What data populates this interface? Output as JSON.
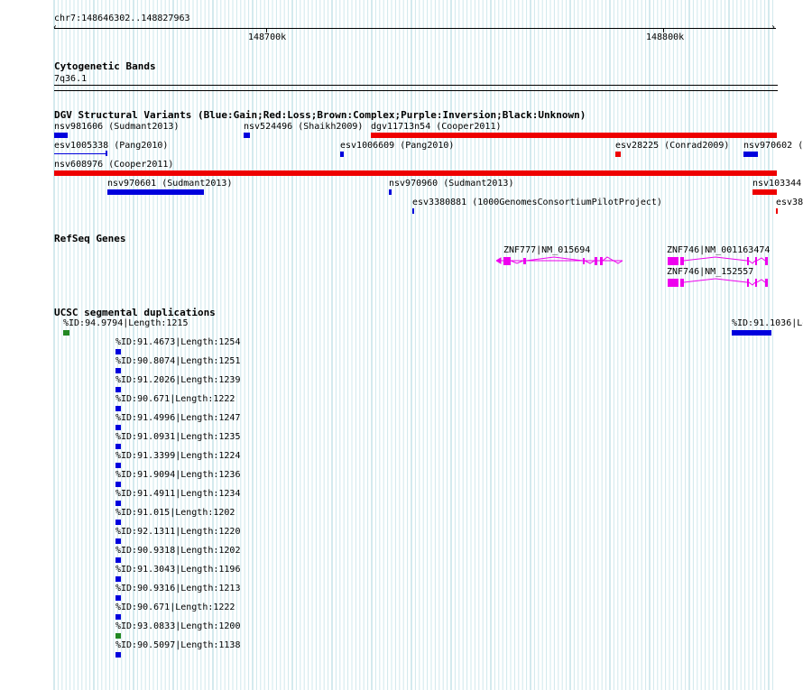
{
  "ruler": {
    "range": "chr7:148646302..148827963",
    "tick1": "148700k",
    "tick2": "148800k"
  },
  "cytoband": {
    "title": "Cytogenetic Bands",
    "band": "7q36.1"
  },
  "dgv": {
    "title": "DGV Structural Variants (Blue:Gain;Red:Loss;Brown:Complex;Purple:Inversion;Black:Unknown)",
    "items": [
      {
        "label": "nsv981606 (Sudmant2013)",
        "color": "#0000dd"
      },
      {
        "label": "nsv524496 (Shaikh2009)",
        "color": "#0000dd"
      },
      {
        "label": "dgv11713n54 (Cooper2011)",
        "color": "#ee0000"
      },
      {
        "label": "esv1005338 (Pang2010)",
        "color": "#0000dd"
      },
      {
        "label": "esv1006609 (Pang2010)",
        "color": "#0000dd"
      },
      {
        "label": "esv28225 (Conrad2009)",
        "color": "#ee0000"
      },
      {
        "label": "nsv970602 (",
        "color": "#0000dd"
      },
      {
        "label": "nsv608976 (Cooper2011)",
        "color": "#ee0000"
      },
      {
        "label": "nsv970601 (Sudmant2013)",
        "color": "#0000dd"
      },
      {
        "label": "nsv970960 (Sudmant2013)",
        "color": "#0000dd"
      },
      {
        "label": "nsv103344",
        "color": "#ee0000"
      },
      {
        "label": "esv3380881 (1000GenomesConsortiumPilotProject)",
        "color": "#0000dd"
      },
      {
        "label": "esv38",
        "color": "#ee0000"
      }
    ]
  },
  "refseq": {
    "title": "RefSeq Genes",
    "genes": [
      {
        "label": "ZNF777|NM_015694",
        "color": "#ee00ee"
      },
      {
        "label": "ZNF746|NM_001163474",
        "color": "#ee00ee"
      },
      {
        "label": "ZNF746|NM_152557",
        "color": "#ee00ee"
      }
    ]
  },
  "segdup": {
    "title": "UCSC segmental duplications",
    "top": [
      {
        "label": "%ID:94.9794|Length:1215",
        "color": "#228822"
      },
      {
        "label": "%ID:91.1036|Le",
        "color": "#0000dd"
      }
    ],
    "items": [
      {
        "label": "%ID:91.4673|Length:1254",
        "color": "#0000dd"
      },
      {
        "label": "%ID:90.8074|Length:1251",
        "color": "#0000dd"
      },
      {
        "label": "%ID:91.2026|Length:1239",
        "color": "#0000dd"
      },
      {
        "label": "%ID:90.671|Length:1222",
        "color": "#0000dd"
      },
      {
        "label": "%ID:91.4996|Length:1247",
        "color": "#0000dd"
      },
      {
        "label": "%ID:91.0931|Length:1235",
        "color": "#0000dd"
      },
      {
        "label": "%ID:91.3399|Length:1224",
        "color": "#0000dd"
      },
      {
        "label": "%ID:91.9094|Length:1236",
        "color": "#0000dd"
      },
      {
        "label": "%ID:91.4911|Length:1234",
        "color": "#0000dd"
      },
      {
        "label": "%ID:91.015|Length:1202",
        "color": "#0000dd"
      },
      {
        "label": "%ID:92.1311|Length:1220",
        "color": "#0000dd"
      },
      {
        "label": "%ID:90.9318|Length:1202",
        "color": "#0000dd"
      },
      {
        "label": "%ID:91.3043|Length:1196",
        "color": "#0000dd"
      },
      {
        "label": "%ID:90.9316|Length:1213",
        "color": "#0000dd"
      },
      {
        "label": "%ID:90.671|Length:1222",
        "color": "#0000dd"
      },
      {
        "label": "%ID:93.0833|Length:1200",
        "color": "#228822"
      },
      {
        "label": "%ID:90.5097|Length:1138",
        "color": "#0000dd"
      }
    ]
  }
}
